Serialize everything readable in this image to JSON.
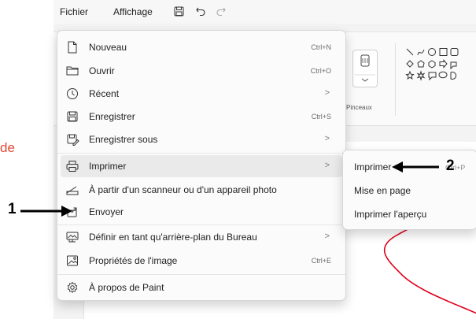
{
  "titlebar": {
    "file_menu": "Fichier",
    "view_menu": "Affichage"
  },
  "left_text": "de",
  "ribbon": {
    "brushes_label": "Pinceaux"
  },
  "menu_items": [
    {
      "label": "Nouveau",
      "shortcut": "Ctrl+N",
      "icon": "new-file-icon"
    },
    {
      "label": "Ouvrir",
      "shortcut": "Ctrl+O",
      "icon": "folder-icon"
    },
    {
      "label": "Récent",
      "icon": "clock-icon",
      "submenu": true
    },
    {
      "label": "Enregistrer",
      "shortcut": "Ctrl+S",
      "icon": "save-icon"
    },
    {
      "label": "Enregistrer sous",
      "icon": "save-as-icon",
      "submenu": true
    },
    {
      "label": "Imprimer",
      "icon": "printer-icon",
      "submenu": true,
      "active": true
    },
    {
      "label": "À partir d'un scanneur ou d'un appareil photo",
      "icon": "scanner-icon"
    },
    {
      "label": "Envoyer",
      "icon": "send-icon"
    },
    {
      "label": "Définir en tant qu'arrière-plan du Bureau",
      "icon": "desktop-icon",
      "submenu": true
    },
    {
      "label": "Propriétés de l'image",
      "shortcut": "Ctrl+E",
      "icon": "image-properties-icon"
    },
    {
      "label": "À propos de Paint",
      "icon": "gear-icon"
    }
  ],
  "submenu_print": {
    "items": [
      "Imprimer",
      "Mise en page",
      "Imprimer l'aperçu"
    ],
    "shortcut_hint": "Ctrl+P"
  },
  "callouts": {
    "one": "1",
    "two": "2"
  },
  "colors": {
    "accent_red": "#e0001b",
    "menu_bg": "#fbfbfb",
    "active_bg": "#eaeaea"
  }
}
